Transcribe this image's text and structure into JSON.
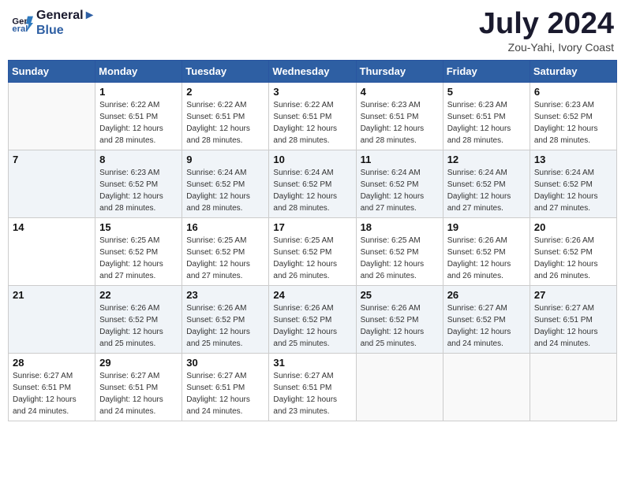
{
  "header": {
    "logo_line1": "General",
    "logo_line2": "Blue",
    "month": "July 2024",
    "location": "Zou-Yahi, Ivory Coast"
  },
  "days_of_week": [
    "Sunday",
    "Monday",
    "Tuesday",
    "Wednesday",
    "Thursday",
    "Friday",
    "Saturday"
  ],
  "weeks": [
    [
      {
        "day": "",
        "detail": ""
      },
      {
        "day": "1",
        "detail": "Sunrise: 6:22 AM\nSunset: 6:51 PM\nDaylight: 12 hours\nand 28 minutes."
      },
      {
        "day": "2",
        "detail": "Sunrise: 6:22 AM\nSunset: 6:51 PM\nDaylight: 12 hours\nand 28 minutes."
      },
      {
        "day": "3",
        "detail": "Sunrise: 6:22 AM\nSunset: 6:51 PM\nDaylight: 12 hours\nand 28 minutes."
      },
      {
        "day": "4",
        "detail": "Sunrise: 6:23 AM\nSunset: 6:51 PM\nDaylight: 12 hours\nand 28 minutes."
      },
      {
        "day": "5",
        "detail": "Sunrise: 6:23 AM\nSunset: 6:51 PM\nDaylight: 12 hours\nand 28 minutes."
      },
      {
        "day": "6",
        "detail": "Sunrise: 6:23 AM\nSunset: 6:52 PM\nDaylight: 12 hours\nand 28 minutes."
      }
    ],
    [
      {
        "day": "7",
        "detail": ""
      },
      {
        "day": "8",
        "detail": "Sunrise: 6:23 AM\nSunset: 6:52 PM\nDaylight: 12 hours\nand 28 minutes."
      },
      {
        "day": "9",
        "detail": "Sunrise: 6:24 AM\nSunset: 6:52 PM\nDaylight: 12 hours\nand 28 minutes."
      },
      {
        "day": "10",
        "detail": "Sunrise: 6:24 AM\nSunset: 6:52 PM\nDaylight: 12 hours\nand 28 minutes."
      },
      {
        "day": "11",
        "detail": "Sunrise: 6:24 AM\nSunset: 6:52 PM\nDaylight: 12 hours\nand 27 minutes."
      },
      {
        "day": "12",
        "detail": "Sunrise: 6:24 AM\nSunset: 6:52 PM\nDaylight: 12 hours\nand 27 minutes."
      },
      {
        "day": "13",
        "detail": "Sunrise: 6:24 AM\nSunset: 6:52 PM\nDaylight: 12 hours\nand 27 minutes."
      }
    ],
    [
      {
        "day": "14",
        "detail": ""
      },
      {
        "day": "15",
        "detail": "Sunrise: 6:25 AM\nSunset: 6:52 PM\nDaylight: 12 hours\nand 27 minutes."
      },
      {
        "day": "16",
        "detail": "Sunrise: 6:25 AM\nSunset: 6:52 PM\nDaylight: 12 hours\nand 27 minutes."
      },
      {
        "day": "17",
        "detail": "Sunrise: 6:25 AM\nSunset: 6:52 PM\nDaylight: 12 hours\nand 26 minutes."
      },
      {
        "day": "18",
        "detail": "Sunrise: 6:25 AM\nSunset: 6:52 PM\nDaylight: 12 hours\nand 26 minutes."
      },
      {
        "day": "19",
        "detail": "Sunrise: 6:26 AM\nSunset: 6:52 PM\nDaylight: 12 hours\nand 26 minutes."
      },
      {
        "day": "20",
        "detail": "Sunrise: 6:26 AM\nSunset: 6:52 PM\nDaylight: 12 hours\nand 26 minutes."
      }
    ],
    [
      {
        "day": "21",
        "detail": ""
      },
      {
        "day": "22",
        "detail": "Sunrise: 6:26 AM\nSunset: 6:52 PM\nDaylight: 12 hours\nand 25 minutes."
      },
      {
        "day": "23",
        "detail": "Sunrise: 6:26 AM\nSunset: 6:52 PM\nDaylight: 12 hours\nand 25 minutes."
      },
      {
        "day": "24",
        "detail": "Sunrise: 6:26 AM\nSunset: 6:52 PM\nDaylight: 12 hours\nand 25 minutes."
      },
      {
        "day": "25",
        "detail": "Sunrise: 6:26 AM\nSunset: 6:52 PM\nDaylight: 12 hours\nand 25 minutes."
      },
      {
        "day": "26",
        "detail": "Sunrise: 6:27 AM\nSunset: 6:52 PM\nDaylight: 12 hours\nand 24 minutes."
      },
      {
        "day": "27",
        "detail": "Sunrise: 6:27 AM\nSunset: 6:51 PM\nDaylight: 12 hours\nand 24 minutes."
      }
    ],
    [
      {
        "day": "28",
        "detail": "Sunrise: 6:27 AM\nSunset: 6:51 PM\nDaylight: 12 hours\nand 24 minutes."
      },
      {
        "day": "29",
        "detail": "Sunrise: 6:27 AM\nSunset: 6:51 PM\nDaylight: 12 hours\nand 24 minutes."
      },
      {
        "day": "30",
        "detail": "Sunrise: 6:27 AM\nSunset: 6:51 PM\nDaylight: 12 hours\nand 24 minutes."
      },
      {
        "day": "31",
        "detail": "Sunrise: 6:27 AM\nSunset: 6:51 PM\nDaylight: 12 hours\nand 23 minutes."
      },
      {
        "day": "",
        "detail": ""
      },
      {
        "day": "",
        "detail": ""
      },
      {
        "day": "",
        "detail": ""
      }
    ]
  ]
}
